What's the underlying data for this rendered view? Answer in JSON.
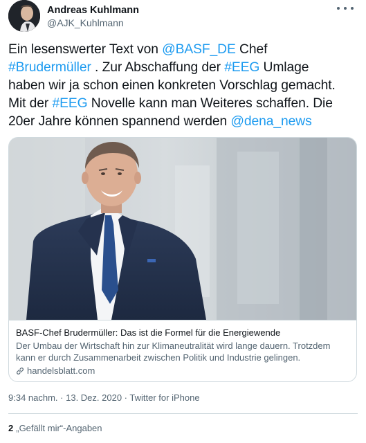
{
  "author": {
    "display_name": "Andreas Kuhlmann",
    "handle": "@AJK_Kuhlmann"
  },
  "tweet": {
    "lines": [
      [
        {
          "text": "Ein lesenswerter Text von ",
          "type": "text"
        },
        {
          "text": "@BASF_DE",
          "type": "link"
        },
        {
          "text": "  Chef",
          "type": "text"
        }
      ],
      [
        {
          "text": "#Brudermüller",
          "type": "link"
        },
        {
          "text": " . Zur Abschaffung der ",
          "type": "text"
        },
        {
          "text": "#EEG",
          "type": "link"
        },
        {
          "text": " Umlage",
          "type": "text"
        }
      ],
      [
        {
          "text": "haben wir ja schon einen konkreten Vorschlag gemacht.",
          "type": "text"
        }
      ],
      [
        {
          "text": "Mit der ",
          "type": "text"
        },
        {
          "text": "#EEG",
          "type": "link"
        },
        {
          "text": " Novelle kann man Weiteres schaffen. Die",
          "type": "text"
        }
      ],
      [
        {
          "text": "20er Jahre können spannend werden ",
          "type": "text"
        },
        {
          "text": "@dena_news",
          "type": "link"
        }
      ]
    ]
  },
  "card": {
    "title": "BASF-Chef Brudermüller: Das ist die Formel für die Energiewende",
    "description": "Der Umbau der Wirtschaft hin zur Klimaneutralität wird lange dauern. Trotzdem kann er durch Zusammenarbeit zwischen Politik und Industrie gelingen.",
    "domain": "handelsblatt.com"
  },
  "meta": {
    "time": "9:34 nachm.",
    "separator_1": " · ",
    "date": "13. Dez. 2020",
    "separator_2": " · ",
    "source": "Twitter for iPhone"
  },
  "engagement": {
    "likes_count": "2",
    "likes_label": "„Gefällt mir“-Angaben"
  },
  "colors": {
    "link": "#1d9bf0",
    "text": "#0f1419",
    "secondary": "#536471",
    "border": "#cfd9de"
  }
}
